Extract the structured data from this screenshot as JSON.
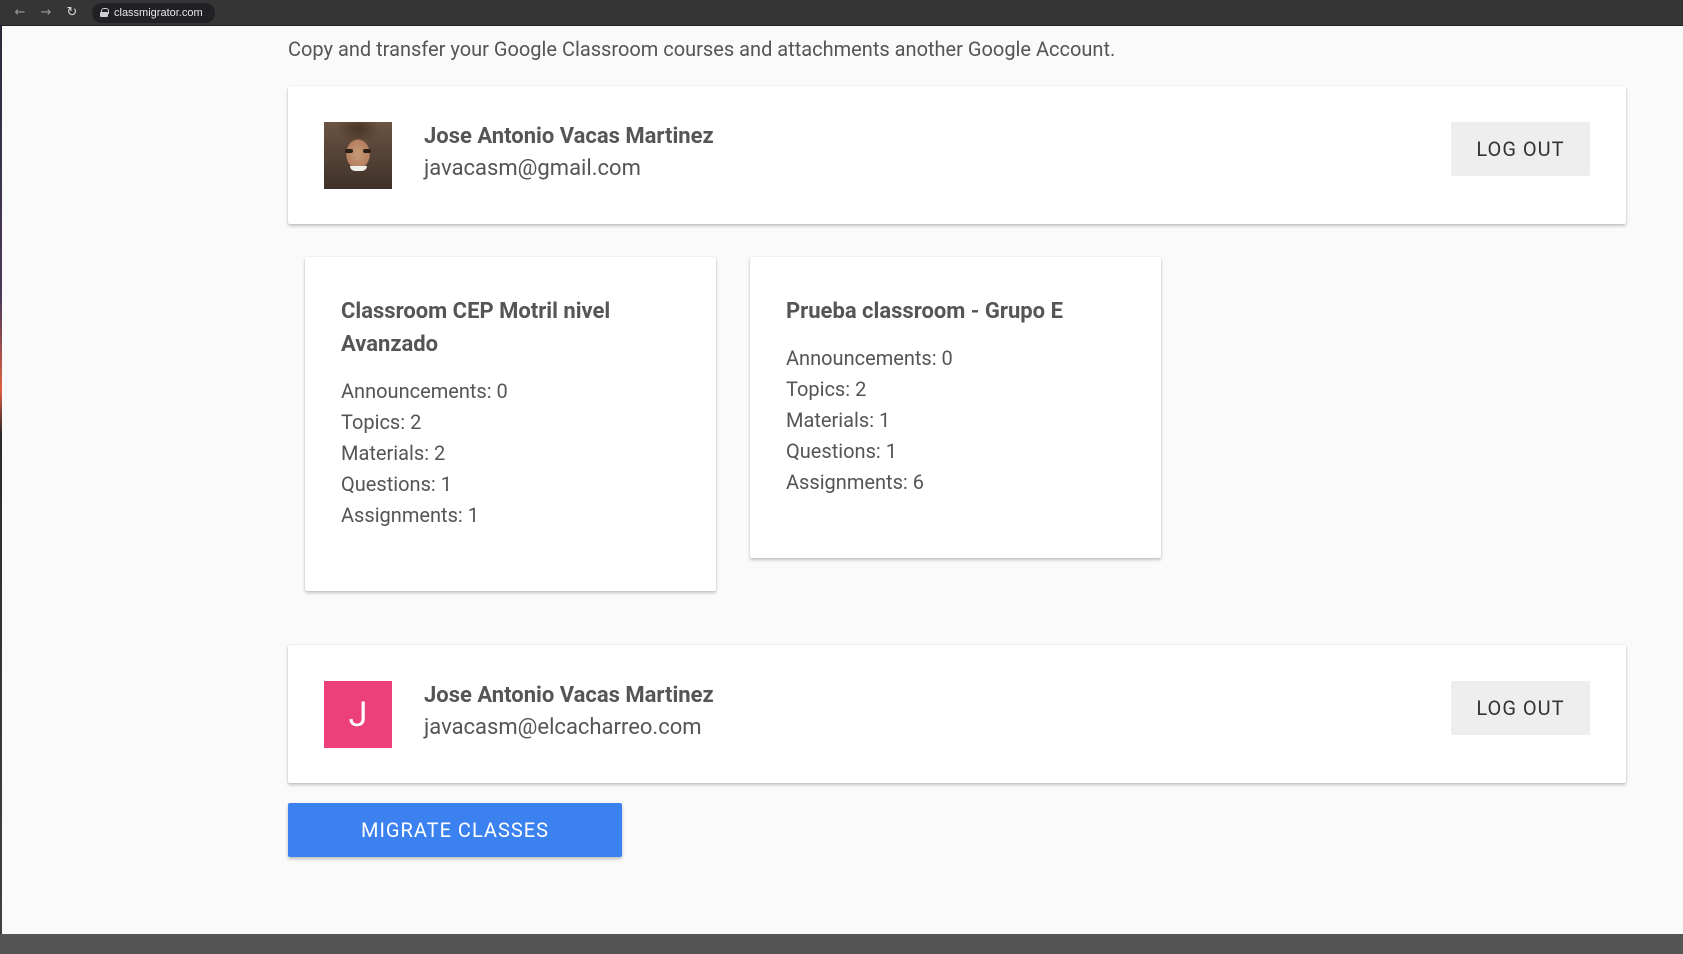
{
  "browser": {
    "url": "classmigrator.com"
  },
  "subtitle": "Copy and transfer your Google Classroom courses and attachments another Google Account.",
  "source_account": {
    "name": "Jose Antonio Vacas Martinez",
    "email": "javacasm@gmail.com",
    "logout_label": "LOG OUT"
  },
  "courses": [
    {
      "title": "Classroom CEP Motril nivel Avanzado",
      "stats": [
        "Announcements: 0",
        "Topics: 2",
        "Materials: 2",
        "Questions: 1",
        "Assignments: 1"
      ]
    },
    {
      "title": "Prueba classroom - Grupo E",
      "stats": [
        "Announcements: 0",
        "Topics: 2",
        "Materials: 1",
        "Questions: 1",
        "Assignments: 6"
      ]
    }
  ],
  "target_account": {
    "avatar_letter": "J",
    "avatar_color": "#ec407a",
    "name": "Jose Antonio Vacas Martinez",
    "email": "javacasm@elcacharreo.com",
    "logout_label": "LOG OUT"
  },
  "migrate_label": "MIGRATE CLASSES",
  "colors": {
    "primary_button": "#3b82f0",
    "text": "#555555"
  }
}
